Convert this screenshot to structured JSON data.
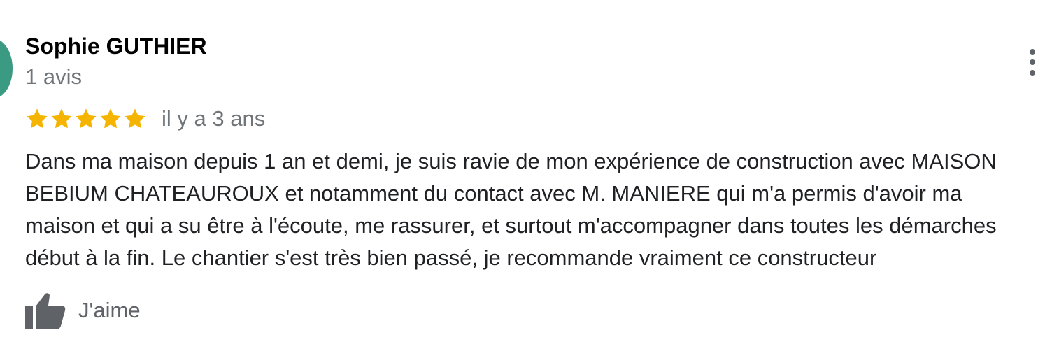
{
  "review": {
    "author": "Sophie GUTHIER",
    "review_count": "1 avis",
    "rating": 5,
    "rating_max": 5,
    "date": "il y a 3 ans",
    "text_lines": [
      "Dans ma maison depuis 1 an et demi, je suis ravie de mon expérience de construction avec MAISON",
      "BEBIUM CHATEAUROUX et notamment du contact avec M. MANIERE qui m'a permis d'avoir ma",
      "maison et qui a su être à l'écoute, me rassurer, et surtout m'accompagner dans toutes les démarches",
      "début à la fin. Le chantier s'est très bien passé, je recommande vraiment ce constructeur"
    ]
  },
  "actions": {
    "like_label": "J'aime",
    "like_icon": "thumbs-up-icon",
    "more_icon": "more-vert-icon"
  },
  "colors": {
    "star": "#f4b400",
    "avatar": "#3a9a82",
    "secondary_text": "#70757a",
    "icon": "#5f6368"
  }
}
